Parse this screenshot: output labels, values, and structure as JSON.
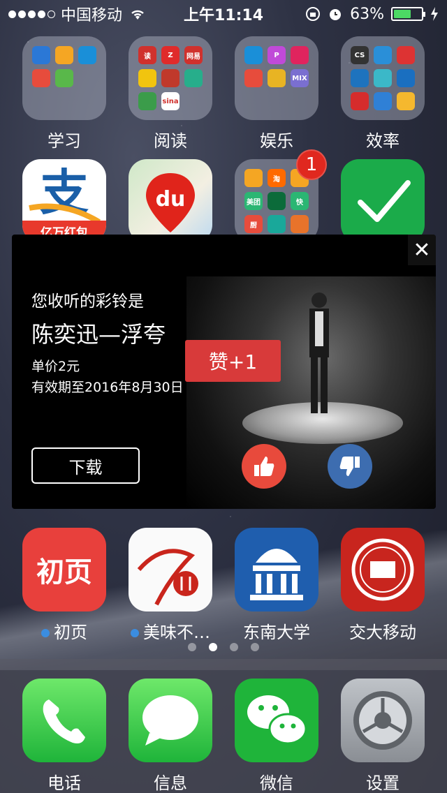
{
  "status": {
    "carrier": "中国移动",
    "time": "上午11:14",
    "battery": "63%",
    "battery_level": 0.63
  },
  "folders": [
    {
      "label": "学习",
      "minis": [
        {
          "text": "",
          "color": "#2b78d6"
        },
        {
          "text": "",
          "color": "#f5a623"
        },
        {
          "text": "",
          "color": "#1a8fd8"
        },
        {
          "text": "",
          "color": "#e74c3c"
        },
        {
          "text": "",
          "color": "#59b84a"
        }
      ]
    },
    {
      "label": "阅读",
      "minis": [
        {
          "text": "读",
          "color": "#d0312d"
        },
        {
          "text": "Z",
          "color": "#e02b2b"
        },
        {
          "text": "网易",
          "color": "#d0312d"
        },
        {
          "text": "",
          "color": "#f1c40f"
        },
        {
          "text": "",
          "color": "#c0392b"
        },
        {
          "text": "",
          "color": "#27ae8b"
        },
        {
          "text": "",
          "color": "#3b9c4a"
        },
        {
          "text": "sina",
          "color": "#ffffff"
        }
      ]
    },
    {
      "label": "娱乐",
      "minis": [
        {
          "text": "",
          "color": "#1a8fd8"
        },
        {
          "text": "P",
          "color": "#c04ad8"
        },
        {
          "text": "",
          "color": "#e0245e"
        },
        {
          "text": "",
          "color": "#e74c3c"
        },
        {
          "text": "",
          "color": "#e8b423"
        },
        {
          "text": "MIX",
          "color": "#7a6fd0"
        }
      ]
    },
    {
      "label": "效率",
      "minis": [
        {
          "text": "CS",
          "color": "#333"
        },
        {
          "text": "",
          "color": "#2a8fd8"
        },
        {
          "text": "",
          "color": "#d33"
        },
        {
          "text": "",
          "color": "#1e73be"
        },
        {
          "text": "",
          "color": "#3bb8c8"
        },
        {
          "text": "",
          "color": "#1a6fc0"
        },
        {
          "text": "",
          "color": "#d62c2c"
        },
        {
          "text": "",
          "color": "#2f80d6"
        },
        {
          "text": "",
          "color": "#f5b82e"
        }
      ]
    }
  ],
  "row2": {
    "alipay_text": "亿万红包",
    "baidu_text": "du",
    "folder_minis": [
      {
        "text": "",
        "color": "#f5a623"
      },
      {
        "text": "淘",
        "color": "#ff6a00"
      },
      {
        "text": "",
        "color": "#f5a623"
      },
      {
        "text": "美团",
        "color": "#2bb673"
      },
      {
        "text": "",
        "color": "#0b6b3a"
      },
      {
        "text": "快",
        "color": "#2bb673"
      },
      {
        "text": "厨",
        "color": "#e74c3c"
      },
      {
        "text": "",
        "color": "#19a89a"
      },
      {
        "text": "",
        "color": "#e8732a"
      }
    ],
    "badge": "1"
  },
  "popup": {
    "subtitle": "您收听的彩铃是",
    "song": "陈奕迅—浮夸",
    "price": "单价2元",
    "valid": "有效期至2016年8月30日",
    "like_tag": "赞+1",
    "download": "下载",
    "close": "✕"
  },
  "row4": [
    {
      "label": "初页",
      "icon_text": "初页",
      "dot": true
    },
    {
      "label": "美味不…",
      "dot": true
    },
    {
      "label": "东南大学",
      "dot": false
    },
    {
      "label": "交大移动",
      "dot": false
    }
  ],
  "dock": [
    {
      "label": "电话"
    },
    {
      "label": "信息"
    },
    {
      "label": "微信"
    },
    {
      "label": "设置"
    }
  ]
}
